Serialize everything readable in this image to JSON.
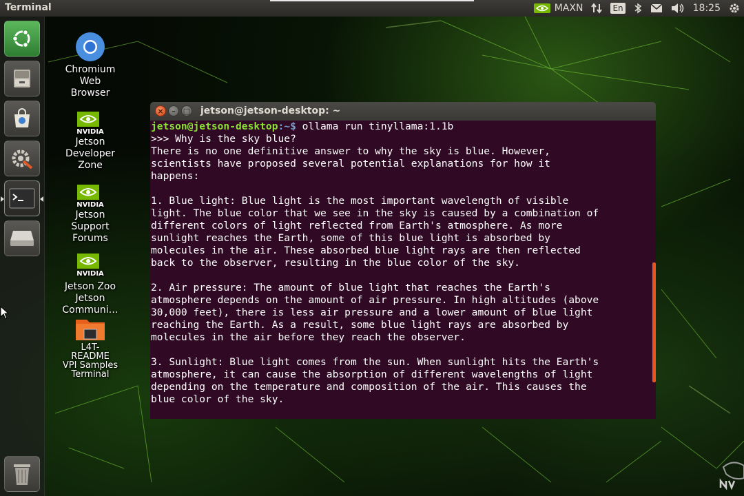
{
  "top_panel": {
    "app_title": "Terminal",
    "power_mode": "MAXN",
    "keyboard_layout": "En",
    "clock": "18:25",
    "icons": [
      "nvidia-icon",
      "network-transfer-icon",
      "bluetooth-icon",
      "mail-icon",
      "volume-icon",
      "settings-gear-icon"
    ]
  },
  "launcher": {
    "items": [
      {
        "name": "ubuntu-dash",
        "icon": "ubuntu-logo-icon"
      },
      {
        "name": "files",
        "icon": "file-cabinet-icon"
      },
      {
        "name": "software-center",
        "icon": "shopping-bag-icon"
      },
      {
        "name": "system-settings",
        "icon": "gear-wrench-icon"
      },
      {
        "name": "terminal",
        "icon": "terminal-icon",
        "active": true
      },
      {
        "name": "drive",
        "icon": "drive-icon"
      },
      {
        "name": "trash",
        "icon": "trash-icon"
      }
    ]
  },
  "desktop": {
    "icons": [
      {
        "label": "Chromium Web Browser",
        "lines": [
          "Chromium",
          "Web",
          "Browser"
        ]
      },
      {
        "label": "Jetson Developer Zone",
        "lines": [
          "Jetson",
          "Developer",
          "Zone"
        ],
        "logo": "NVIDIA"
      },
      {
        "label": "Jetson Support Forums",
        "lines": [
          "Jetson",
          "Support",
          "Forums"
        ],
        "logo": "NVIDIA"
      },
      {
        "label": "Jetson Zoo / Jetson Communi…",
        "lines": [
          "Jetson Zoo",
          "Jetson",
          "Communi…"
        ],
        "logo": "NVIDIA"
      },
      {
        "label": "L4T-README / VPI Samples / Terminal",
        "lines": [
          "L4T-",
          "README",
          "VPI Samples",
          "Terminal"
        ]
      }
    ]
  },
  "terminal": {
    "title": "jetson@jetson-desktop: ~",
    "prompt_user": "jetson@jetson-desktop",
    "prompt_path": ":~$",
    "command": " ollama run tinyllama:1.1b",
    "output": ">>> Why is the sky blue?\nThere is no one definitive answer to why the sky is blue. However,\nscientists have proposed several potential explanations for how it\nhappens:\n\n1. Blue light: Blue light is the most important wavelength of visible\nlight. The blue color that we see in the sky is caused by a combination of\ndifferent colors of light reflected from Earth's atmosphere. As more\nsunlight reaches the Earth, some of this blue light is absorbed by\nmolecules in the air. These absorbed blue light rays are then reflected\nback to the observer, resulting in the blue color of the sky.\n\n2. Air pressure: The amount of blue light that reaches the Earth's\natmosphere depends on the amount of air pressure. In high altitudes (above\n30,000 feet), there is less air pressure and a lower amount of blue light\nreaching the Earth. As a result, some blue light rays are absorbed by\nmolecules in the air before they reach the observer.\n\n3. Sunlight: Blue light comes from the sun. When sunlight hits the Earth's\natmosphere, it can cause the absorption of different wavelengths of light\ndepending on the temperature and composition of the air. This causes the\nblue color of the sky.",
    "colors": {
      "background": "#300a24",
      "prompt_user": "#8ae234",
      "prompt_path": "#729fcf",
      "scrollbar": "#e95420"
    }
  }
}
